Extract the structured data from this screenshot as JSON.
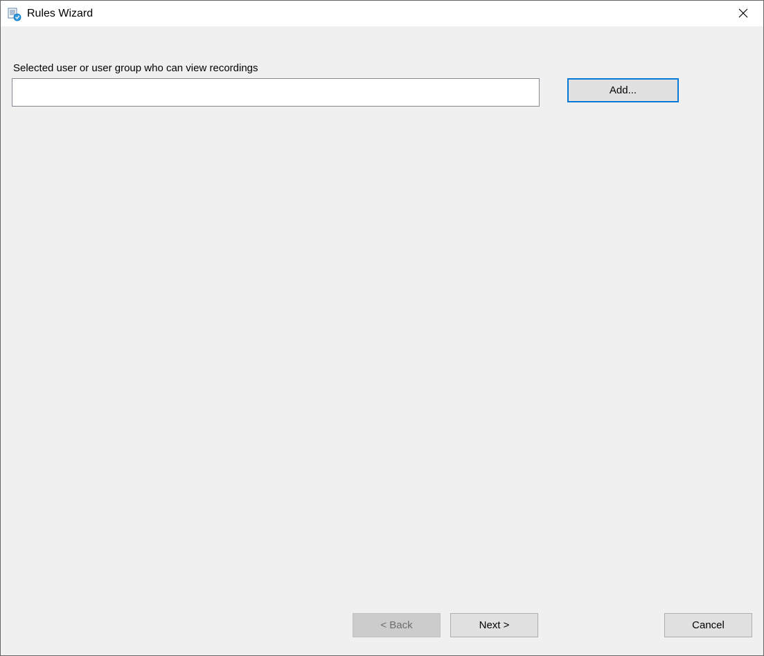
{
  "window": {
    "title": "Rules Wizard"
  },
  "main": {
    "field_label": "Selected user or user group who can view recordings",
    "user_list_value": "",
    "add_button": "Add..."
  },
  "buttons": {
    "back": "< Back",
    "next": "Next >",
    "cancel": "Cancel"
  }
}
